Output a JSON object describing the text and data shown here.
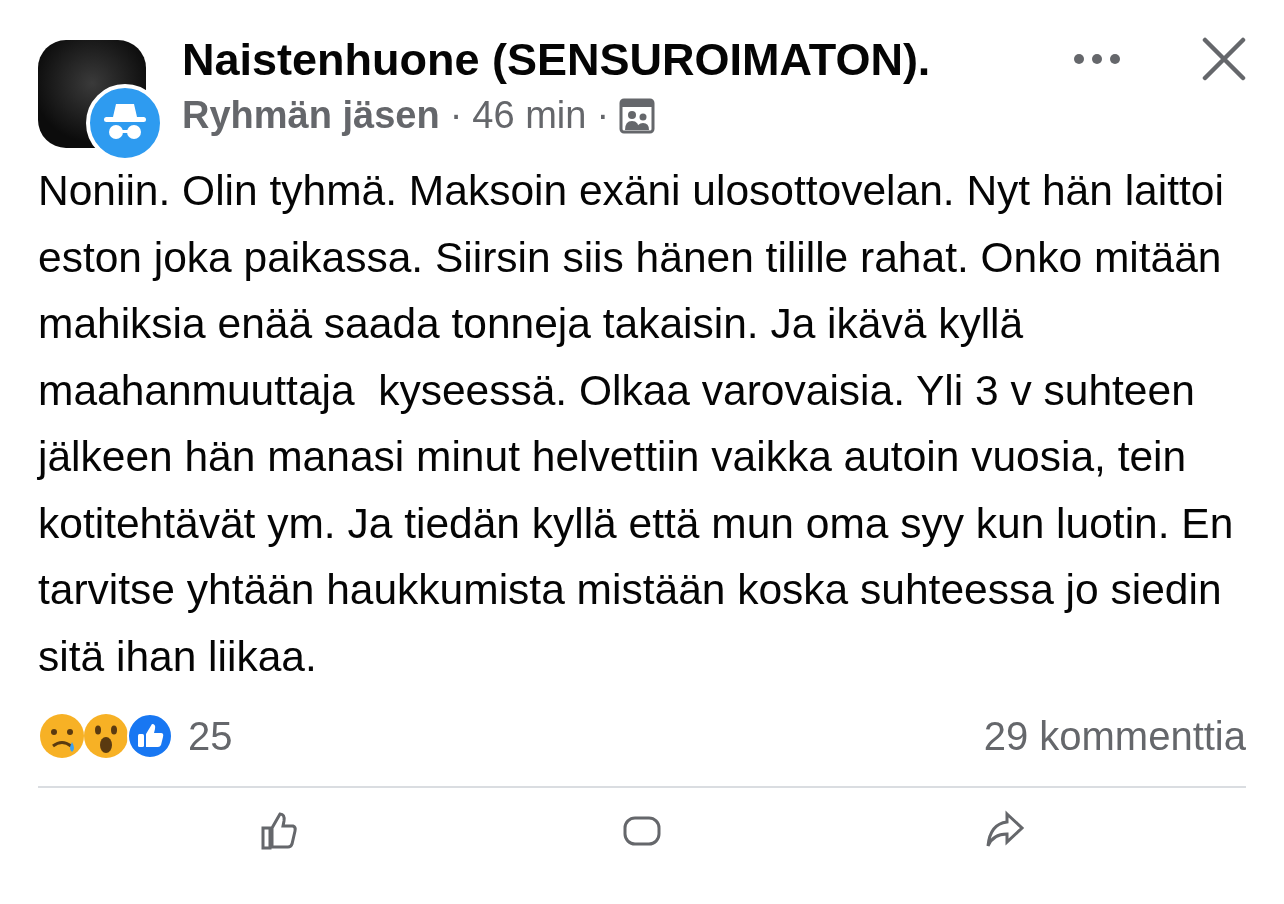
{
  "post": {
    "group_name": "Naistenhuone (SENSUROIMATON).",
    "author_label": "Ryhmän jäsen",
    "time": "46 min",
    "separator": "·",
    "body": "Noniin. Olin tyhmä. Maksoin exäni ulosottovelan. Nyt hän laittoi eston joka paikassa. Siirsin siis hänen tilille rahat. Onko mitään mahiksia enää saada tonneja takaisin. Ja ikävä kyllä maahanmuuttaja  kyseessä. Olkaa varovaisia. Yli 3 v suhteen jälkeen hän manasi minut helvettiin vaikka autoin vuosia, tein kotitehtävät ym. Ja tiedän kyllä että mun oma syy kun luotin. En tarvitse yhtään haukkumista mistään koska suhteessa jo siedin sitä ihan liikaa.",
    "reactions": [
      {
        "kind": "sad"
      },
      {
        "kind": "wow"
      },
      {
        "kind": "like"
      }
    ],
    "reaction_count": "25",
    "comments": "29 kommenttia"
  }
}
